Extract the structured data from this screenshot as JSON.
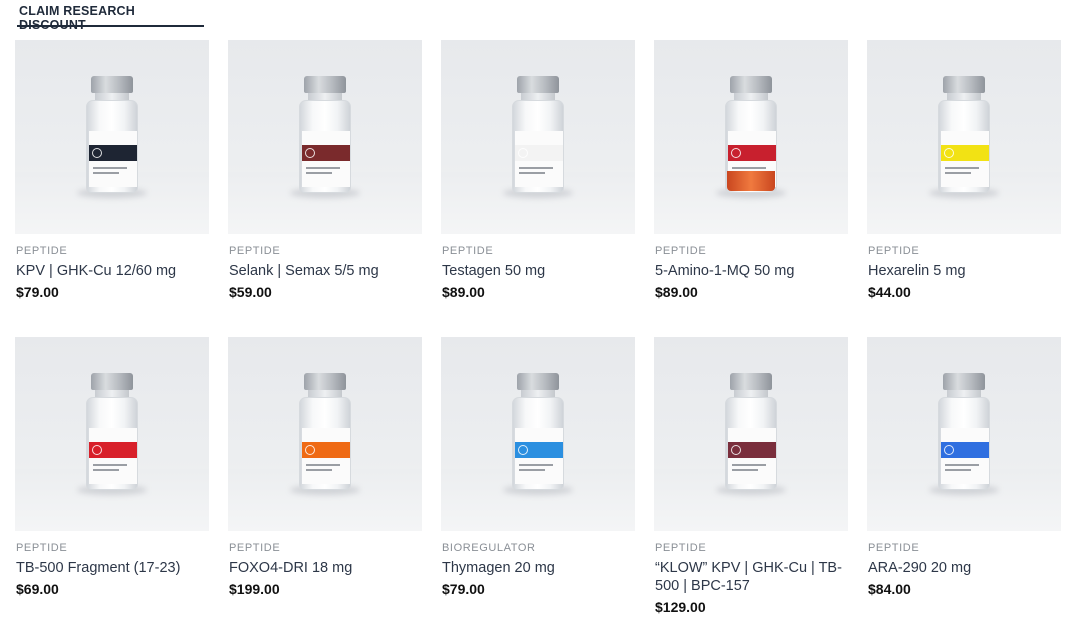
{
  "tab": {
    "label": "CLAIM RESEARCH DISCOUNT"
  },
  "products": [
    {
      "category": "PEPTIDE",
      "name": "KPV | GHK-Cu 12/60 mg",
      "price": "$79.00",
      "band_color": "#1e2533"
    },
    {
      "category": "PEPTIDE",
      "name": "Selank | Semax 5/5 mg",
      "price": "$59.00",
      "band_color": "#7a2a2c"
    },
    {
      "category": "PEPTIDE",
      "name": "Testagen 50 mg",
      "price": "$89.00",
      "band_color": "#f3f3f3"
    },
    {
      "category": "PEPTIDE",
      "name": "5-Amino-1-MQ 50 mg",
      "price": "$89.00",
      "band_color": "#c8202e"
    },
    {
      "category": "PEPTIDE",
      "name": "Hexarelin 5 mg",
      "price": "$44.00",
      "band_color": "#f2e214"
    },
    {
      "category": "PEPTIDE",
      "name": "TB-500 Fragment (17-23)",
      "price": "$69.00",
      "band_color": "#d8202a"
    },
    {
      "category": "PEPTIDE",
      "name": "FOXO4-DRI 18 mg",
      "price": "$199.00",
      "band_color": "#ef6a14"
    },
    {
      "category": "BIOREGULATOR",
      "name": "Thymagen 20 mg",
      "price": "$79.00",
      "band_color": "#2b8fe0"
    },
    {
      "category": "PEPTIDE",
      "name": "“KLOW” KPV | GHK-Cu | TB-500 | BPC-157",
      "price": "$129.00",
      "band_color": "#7a2e3c"
    },
    {
      "category": "PEPTIDE",
      "name": "ARA-290 20 mg",
      "price": "$84.00",
      "band_color": "#2f6fe0"
    }
  ]
}
